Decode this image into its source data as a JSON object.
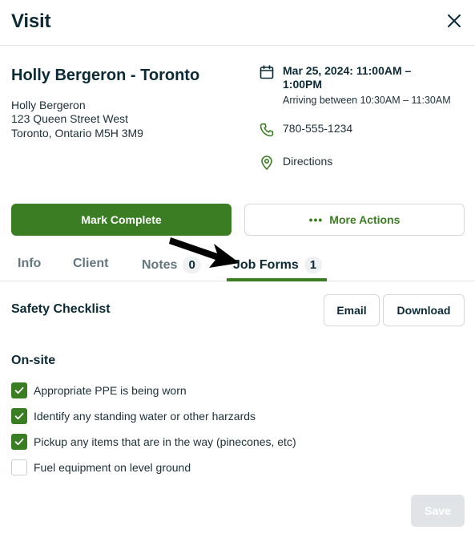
{
  "header": {
    "title": "Visit",
    "close_icon": "close-icon"
  },
  "client": {
    "heading": "Holly Bergeron - Toronto",
    "address_lines": [
      "Holly Bergeron",
      "123 Queen Street West",
      "Toronto, Ontario M5H 3M9"
    ]
  },
  "schedule": {
    "date_line1": "Mar 25, 2024: 11:00AM –",
    "date_line2": "1:00PM",
    "arriving": "Arriving between 10:30AM – 11:30AM",
    "phone": "780-555-1234",
    "directions": "Directions"
  },
  "actions": {
    "mark_complete": "Mark Complete",
    "more_dots": "•••",
    "more_actions": "More Actions"
  },
  "tabs": [
    {
      "label": "Info"
    },
    {
      "label": "Client"
    },
    {
      "label": "Notes",
      "count": "0"
    },
    {
      "label": "Job Forms",
      "count": "1",
      "active": true
    }
  ],
  "form": {
    "title": "Safety Checklist",
    "email_label": "Email",
    "download_label": "Download",
    "section": "On-site",
    "items": [
      {
        "label": "Appropriate PPE is being worn",
        "checked": true
      },
      {
        "label": "Identify any standing water or other harzards",
        "checked": true
      },
      {
        "label": "Pickup any items that are in the way (pinecones, etc)",
        "checked": true
      },
      {
        "label": "Fuel equipment on level ground",
        "checked": false
      }
    ],
    "save_label": "Save"
  },
  "colors": {
    "brand_green": "#3a7d23",
    "text_dark": "#0b2a36",
    "muted": "#647680",
    "disabled": "#e1e4e6"
  }
}
